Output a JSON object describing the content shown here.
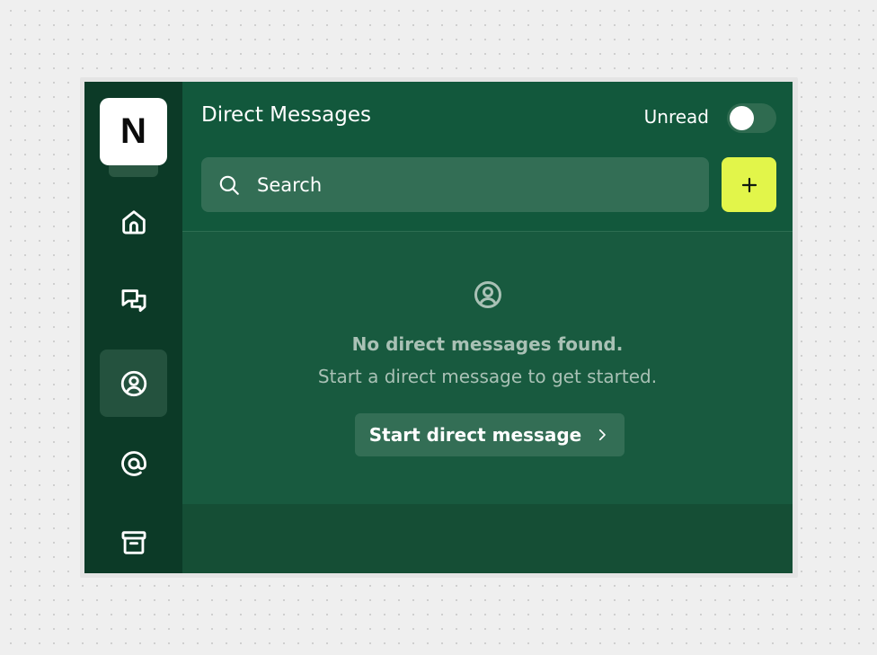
{
  "workspace": {
    "initial": "N"
  },
  "nav": {
    "items": [
      {
        "name": "home",
        "icon": "home-icon"
      },
      {
        "name": "chats",
        "icon": "chat-bubbles-icon"
      },
      {
        "name": "direct-messages",
        "icon": "user-circle-icon",
        "active": true
      },
      {
        "name": "mentions",
        "icon": "at-sign-icon"
      },
      {
        "name": "archive",
        "icon": "archive-box-icon"
      }
    ]
  },
  "header": {
    "title": "Direct Messages",
    "unread_label": "Unread",
    "unread_on": false
  },
  "search": {
    "placeholder": "Search"
  },
  "empty_state": {
    "icon": "user-circle-icon",
    "line1": "No direct messages found.",
    "line2": "Start a direct message to get started.",
    "button_label": "Start direct message"
  },
  "colors": {
    "rail_bg": "#0c3a27",
    "main_bg": "#185a3f",
    "accent": "#e2f54a",
    "muted_text": "#a9c1b5"
  }
}
